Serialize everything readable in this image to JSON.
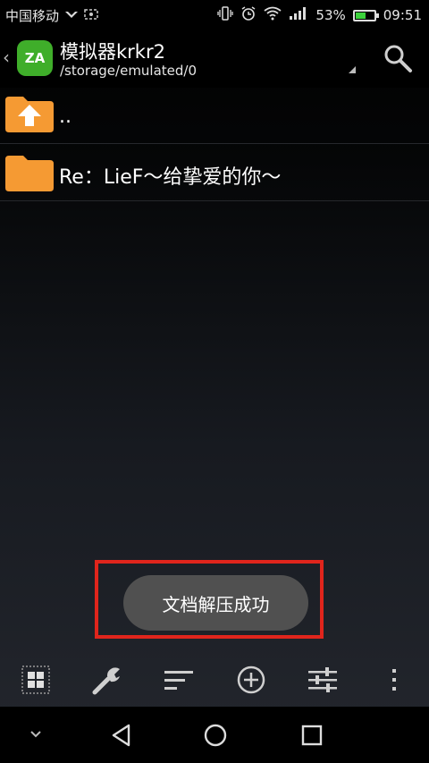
{
  "status_bar": {
    "carrier": "中国移动",
    "battery_percent": "53%",
    "battery_level": 0.53,
    "time": "09:51"
  },
  "header": {
    "title": "模拟器krkr2",
    "path": "/storage/emulated/0",
    "app_icon_text": "ZA"
  },
  "files": [
    {
      "label": "..",
      "icon": "folder-up-icon"
    },
    {
      "label": "Re：LieF～给挚爱的你～",
      "icon": "folder-icon"
    }
  ],
  "toast": {
    "message": "文档解压成功"
  },
  "colors": {
    "folder": "#f59a33",
    "app_icon": "#3fae2a",
    "toast_bg": "#505050",
    "highlight_frame": "#e0251c",
    "battery_fill": "#3cd23c"
  },
  "toolbar": {
    "items": [
      "grid-view-icon",
      "wrench-icon",
      "sort-icon",
      "add-circle-icon",
      "settings-sliders-icon",
      "more-vertical-icon"
    ]
  },
  "nav_bar": {
    "items": [
      "chevron-down-icon",
      "back-icon",
      "home-icon",
      "recents-icon"
    ]
  }
}
